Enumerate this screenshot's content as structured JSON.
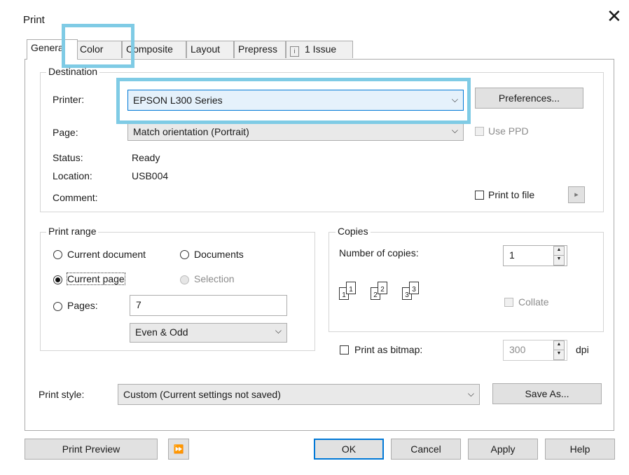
{
  "dialog": {
    "title": "Print"
  },
  "tabs": [
    {
      "label": "General",
      "active": true
    },
    {
      "label": "Color"
    },
    {
      "label": "Composite"
    },
    {
      "label": "Layout"
    },
    {
      "label": "Prepress"
    },
    {
      "label": "1 Issue",
      "icon": "info-icon"
    }
  ],
  "destination": {
    "legend": "Destination",
    "printer_label": "Printer:",
    "printer_value": "EPSON L300 Series",
    "preferences_label": "Preferences...",
    "page_label": "Page:",
    "page_value": "Match orientation (Portrait)",
    "use_ppd_label": "Use PPD",
    "status_label": "Status:",
    "status_value": "Ready",
    "location_label": "Location:",
    "location_value": "USB004",
    "comment_label": "Comment:",
    "print_to_file_label": "Print to file",
    "print_to_file_arrow": "▸"
  },
  "print_range": {
    "legend": "Print range",
    "current_document": "Current document",
    "documents": "Documents",
    "current_page": "Current page",
    "selection": "Selection",
    "pages": "Pages:",
    "pages_value": "7",
    "even_odd": "Even & Odd",
    "selected": "current_page"
  },
  "copies": {
    "legend": "Copies",
    "number_label": "Number of copies:",
    "number_value": "1",
    "collate_label": "Collate",
    "print_as_bitmap_label": "Print as bitmap:",
    "dpi_value": "300",
    "dpi_unit": "dpi",
    "collate_pages": [
      "1",
      "1",
      "2",
      "2",
      "3",
      "3"
    ]
  },
  "print_style": {
    "label": "Print style:",
    "value": "Custom (Current settings not saved)",
    "save_as_label": "Save As..."
  },
  "footer": {
    "print_preview": "Print Preview",
    "ok": "OK",
    "cancel": "Cancel",
    "apply": "Apply",
    "help": "Help"
  },
  "colors": {
    "highlight": "#7fcbe5",
    "accent": "#0078d7"
  }
}
